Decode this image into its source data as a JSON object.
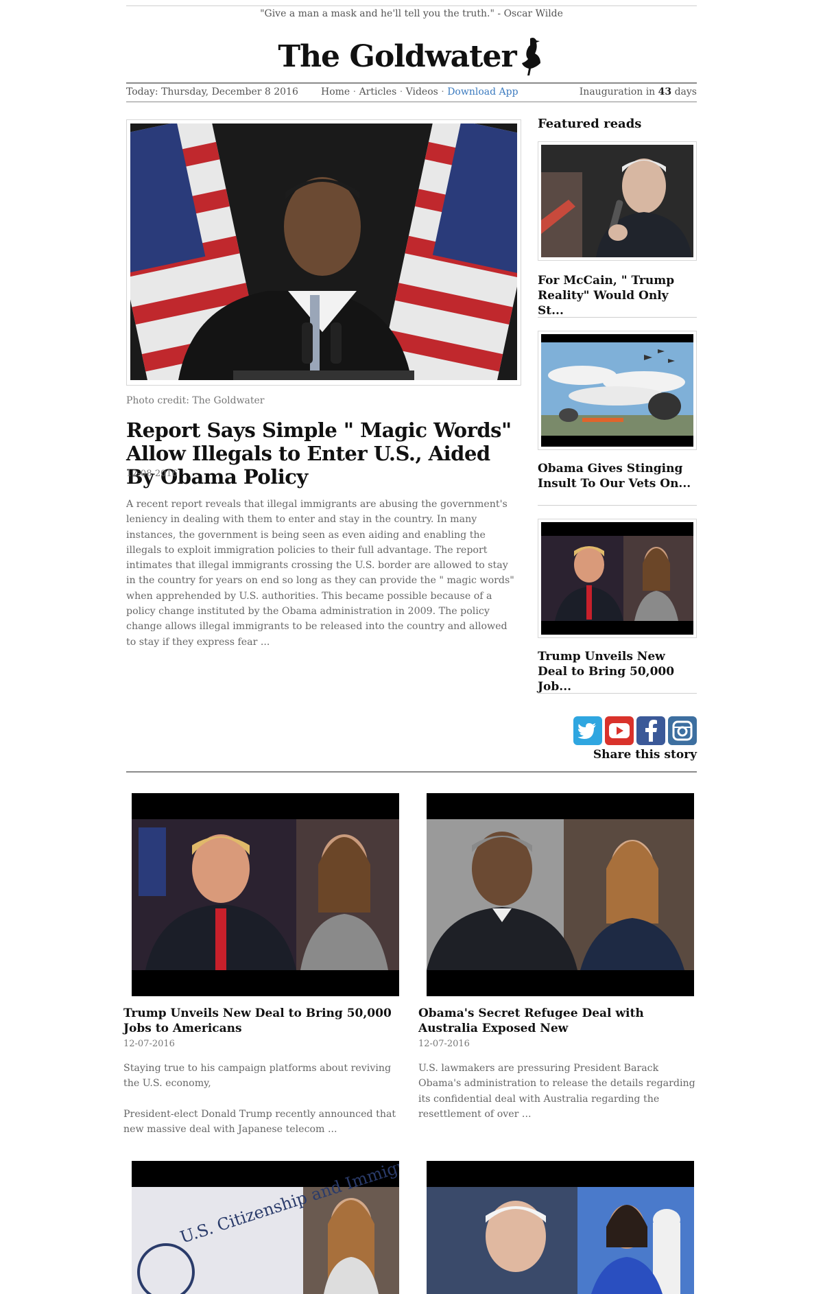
{
  "masthead": {
    "quote": "\"Give a man a mask and he'll tell you the truth.\" - Oscar Wilde",
    "logo": "The Goldwater"
  },
  "navbar": {
    "today_label": "Today: Thursday, December 8 2016",
    "links": [
      "Home",
      "Articles",
      "Videos",
      "Download App"
    ],
    "separator": "·",
    "inauguration_prefix": "Inauguration in",
    "inauguration_days": "43",
    "inauguration_suffix": "days"
  },
  "hero": {
    "credit": "Photo credit: The Goldwater",
    "title": "Report Says Simple \" Magic Words\" Allow Illegals to Enter U.S., Aided By Obama Policy",
    "date": "12-08-2016",
    "body": "A recent report reveals that illegal immigrants are abusing the government's leniency in dealing with them to enter and stay in the country. In many instances, the government is being seen as even aiding and enabling the illegals to exploit immigration policies to their full advantage. The report intimates that illegal immigrants crossing the U.S. border are allowed to stay in the country for years on end so long as they can provide the \" magic words\" when apprehended by U.S. authorities. This became possible because of a policy change instituted by the Obama administration in 2009. The policy change allows illegal immigrants to be released into the country and allowed to stay if they express fear ..."
  },
  "featured": {
    "heading": "Featured reads",
    "items": [
      {
        "title": "For McCain, \" Trump Reality\" Would Only St..."
      },
      {
        "title": "Obama Gives Stinging Insult To Our Vets On..."
      },
      {
        "title": "Trump Unveils New Deal to Bring 50,000 Job..."
      }
    ]
  },
  "social": {
    "icons": [
      "twitter-icon",
      "youtube-icon",
      "facebook-icon",
      "instagram-icon"
    ],
    "share_label": "Share this story",
    "colors": {
      "twitter": "#2fa6e0",
      "youtube": "#d9322b",
      "facebook": "#3b5998",
      "instagram": "#3d6fa0"
    }
  },
  "articles": [
    {
      "title": "Trump Unveils New Deal to Bring 50,000 Jobs to Americans",
      "date": "12-07-2016",
      "paragraphs": [
        "Staying true to his campaign platforms about reviving the U.S. economy,",
        "President-elect Donald Trump recently announced that new massive deal with Japanese telecom ..."
      ]
    },
    {
      "title": "Obama's Secret Refugee Deal with Australia Exposed New",
      "date": "12-07-2016",
      "paragraphs": [
        "U.S. lawmakers are pressuring President Barack Obama's administration to release the details regarding its confidential deal with Australia regarding the resettlement of over ..."
      ]
    }
  ],
  "bottom_images": {
    "left_text": "U.S. Citizenship and Immigration Services"
  },
  "colors": {
    "accent_link": "#3a7abf",
    "rule": "#8a8a8a",
    "text_muted": "#666666"
  }
}
